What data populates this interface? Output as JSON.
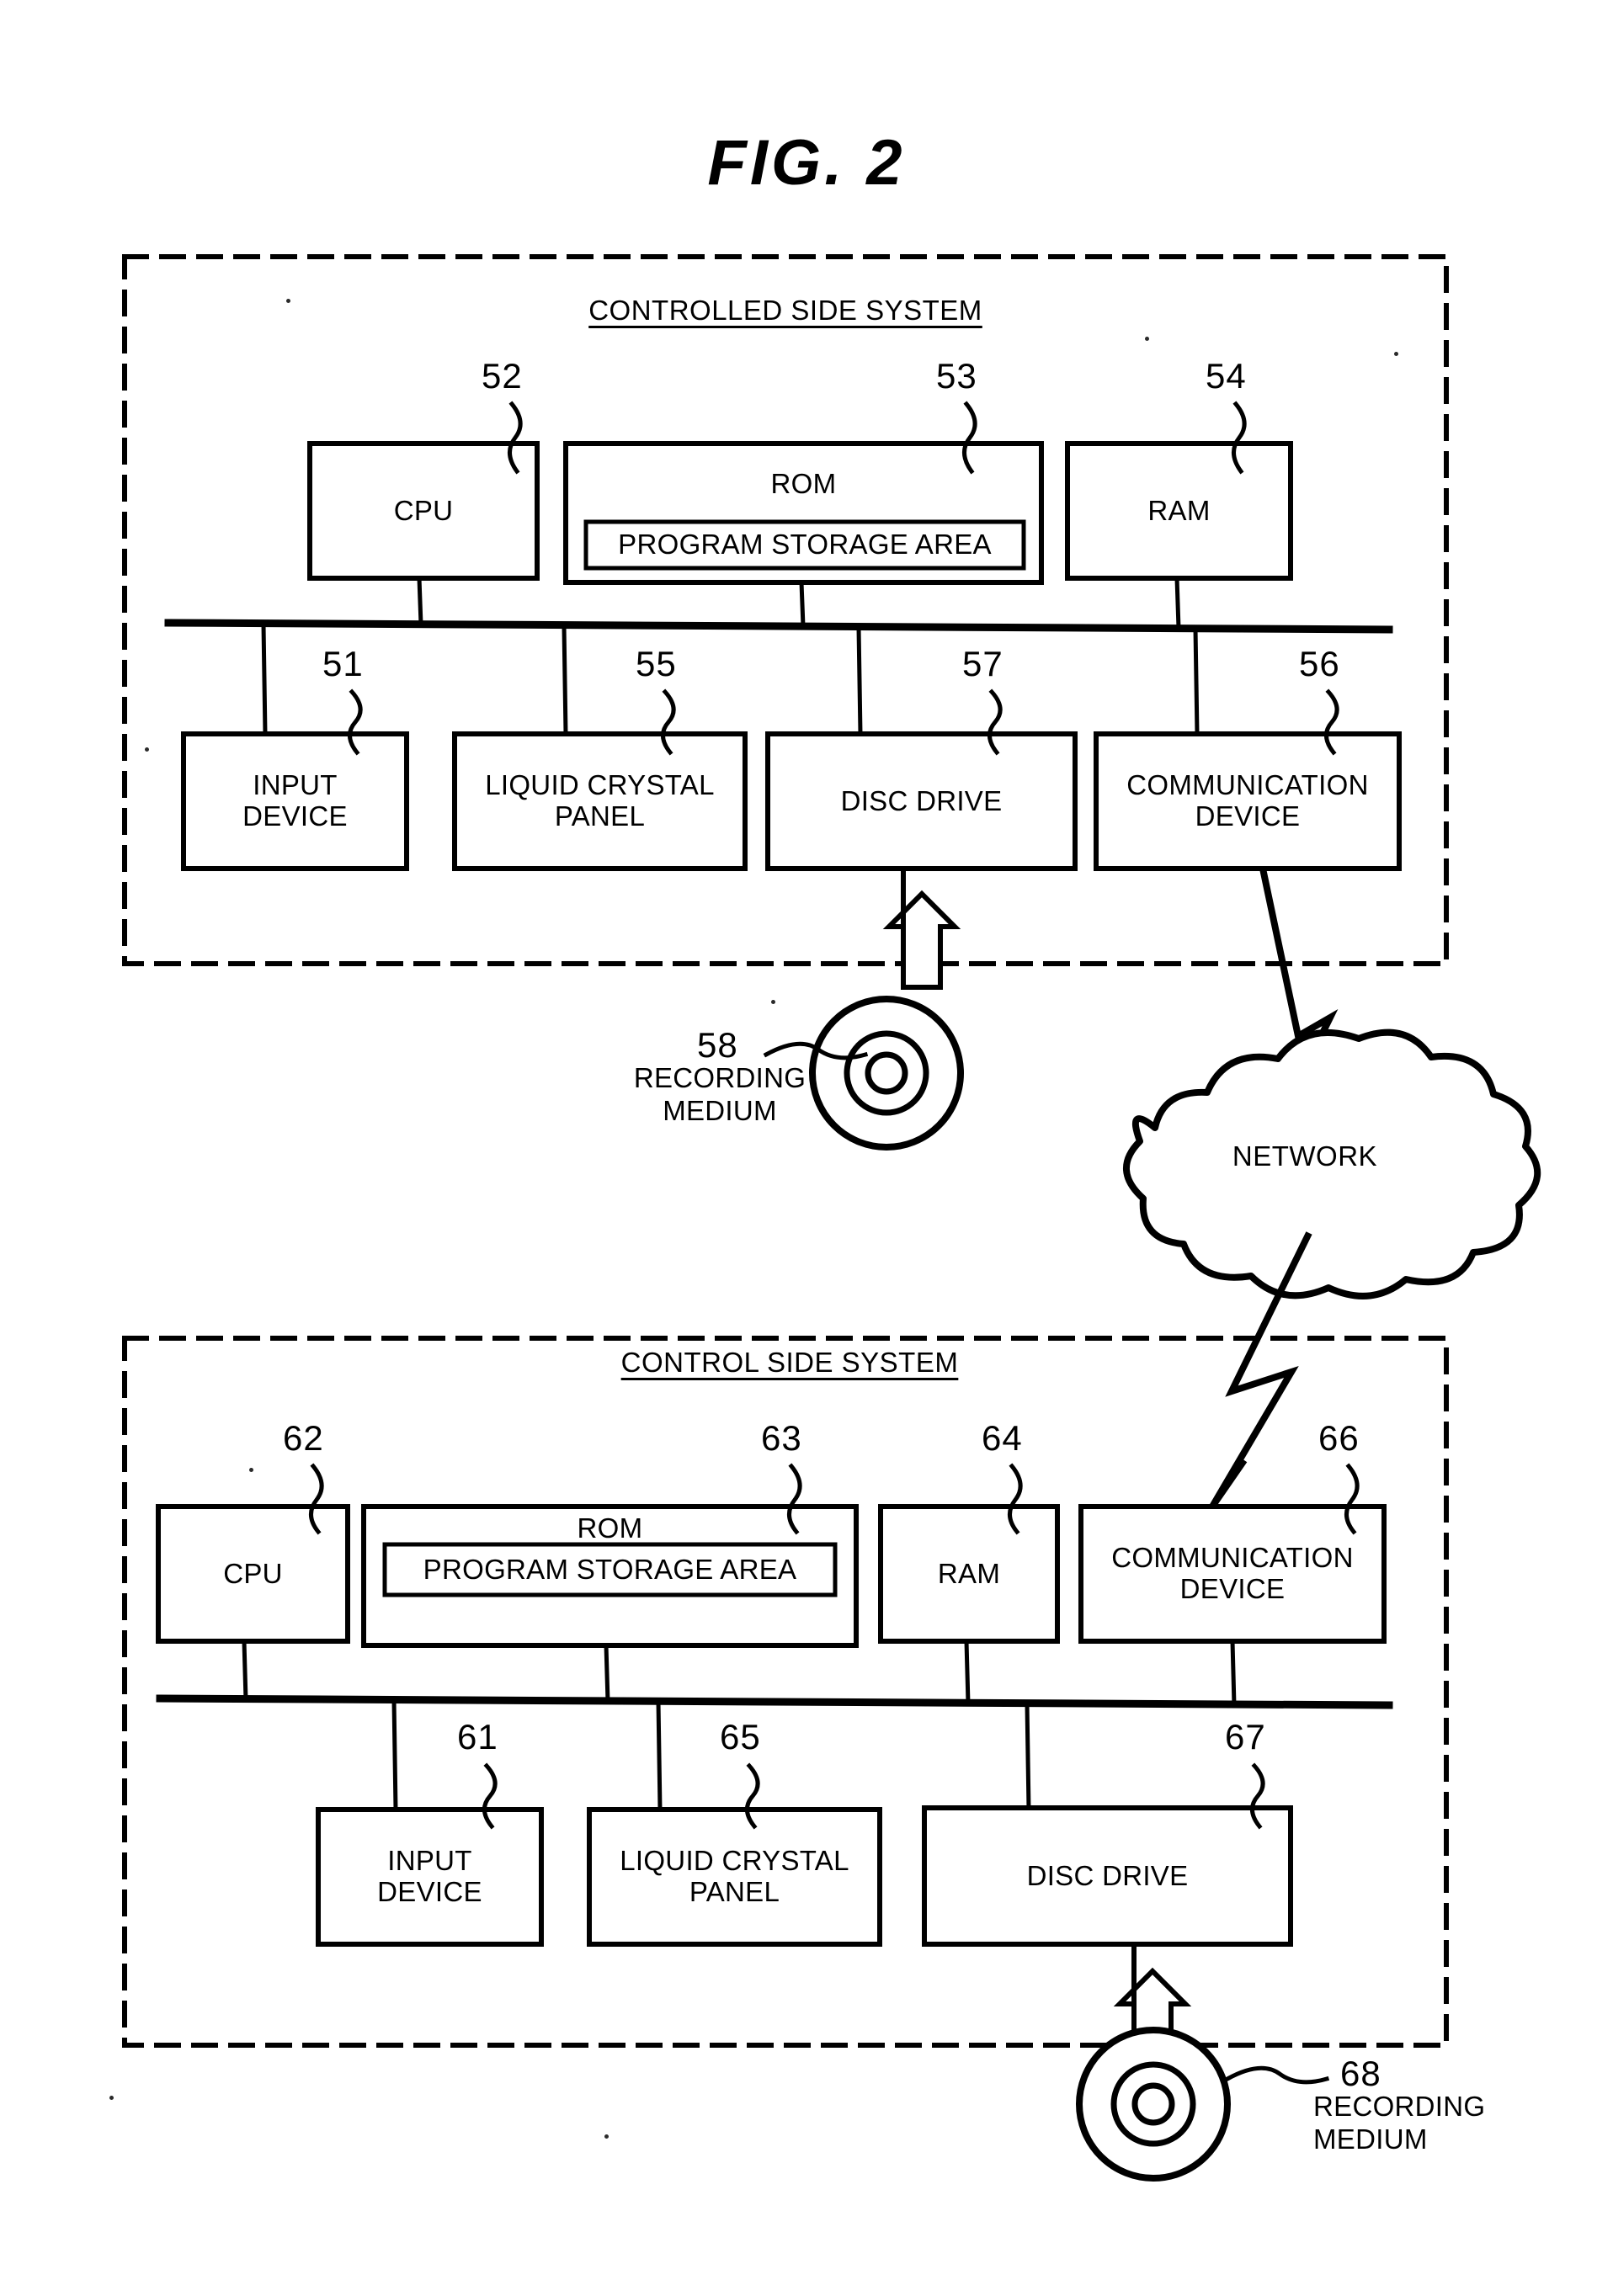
{
  "figure": {
    "title": "FIG.  2"
  },
  "controlled_side": {
    "title": "CONTROLLED SIDE SYSTEM",
    "top_row": [
      {
        "label": "CPU",
        "ref": "52"
      },
      {
        "label": "ROM",
        "ref": "53",
        "inner_label": "PROGRAM STORAGE AREA"
      },
      {
        "label": "RAM",
        "ref": "54"
      }
    ],
    "bottom_row": [
      {
        "label": "INPUT\nDEVICE",
        "line1": "INPUT",
        "line2": "DEVICE",
        "ref": "51"
      },
      {
        "label": "LIQUID CRYSTAL\nPANEL",
        "line1": "LIQUID CRYSTAL",
        "line2": "PANEL",
        "ref": "55"
      },
      {
        "label": "DISC DRIVE",
        "line1": "DISC DRIVE",
        "line2": "",
        "ref": "57"
      },
      {
        "label": "COMMUNICATION\nDEVICE",
        "line1": "COMMUNICATION",
        "line2": "DEVICE",
        "ref": "56"
      }
    ],
    "recording_medium": {
      "ref": "58",
      "line1": "RECORDING",
      "line2": "MEDIUM"
    }
  },
  "network": {
    "label": "NETWORK"
  },
  "control_side": {
    "title": "CONTROL SIDE SYSTEM",
    "top_row": [
      {
        "label": "CPU",
        "ref": "62"
      },
      {
        "label": "ROM",
        "ref": "63",
        "inner_label": "PROGRAM STORAGE AREA"
      },
      {
        "label": "RAM",
        "ref": "64"
      },
      {
        "label": "COMMUNICATION\nDEVICE",
        "line1": "COMMUNICATION",
        "line2": "DEVICE",
        "ref": "66"
      }
    ],
    "bottom_row": [
      {
        "label": "INPUT\nDEVICE",
        "line1": "INPUT",
        "line2": "DEVICE",
        "ref": "61"
      },
      {
        "label": "LIQUID CRYSTAL\nPANEL",
        "line1": "LIQUID CRYSTAL",
        "line2": "PANEL",
        "ref": "65"
      },
      {
        "label": "DISC DRIVE",
        "line1": "DISC DRIVE",
        "line2": "",
        "ref": "67"
      }
    ],
    "recording_medium": {
      "ref": "68",
      "line1": "RECORDING",
      "line2": "MEDIUM"
    }
  },
  "colors": {
    "ink": "#000000",
    "paper": "#ffffff"
  }
}
